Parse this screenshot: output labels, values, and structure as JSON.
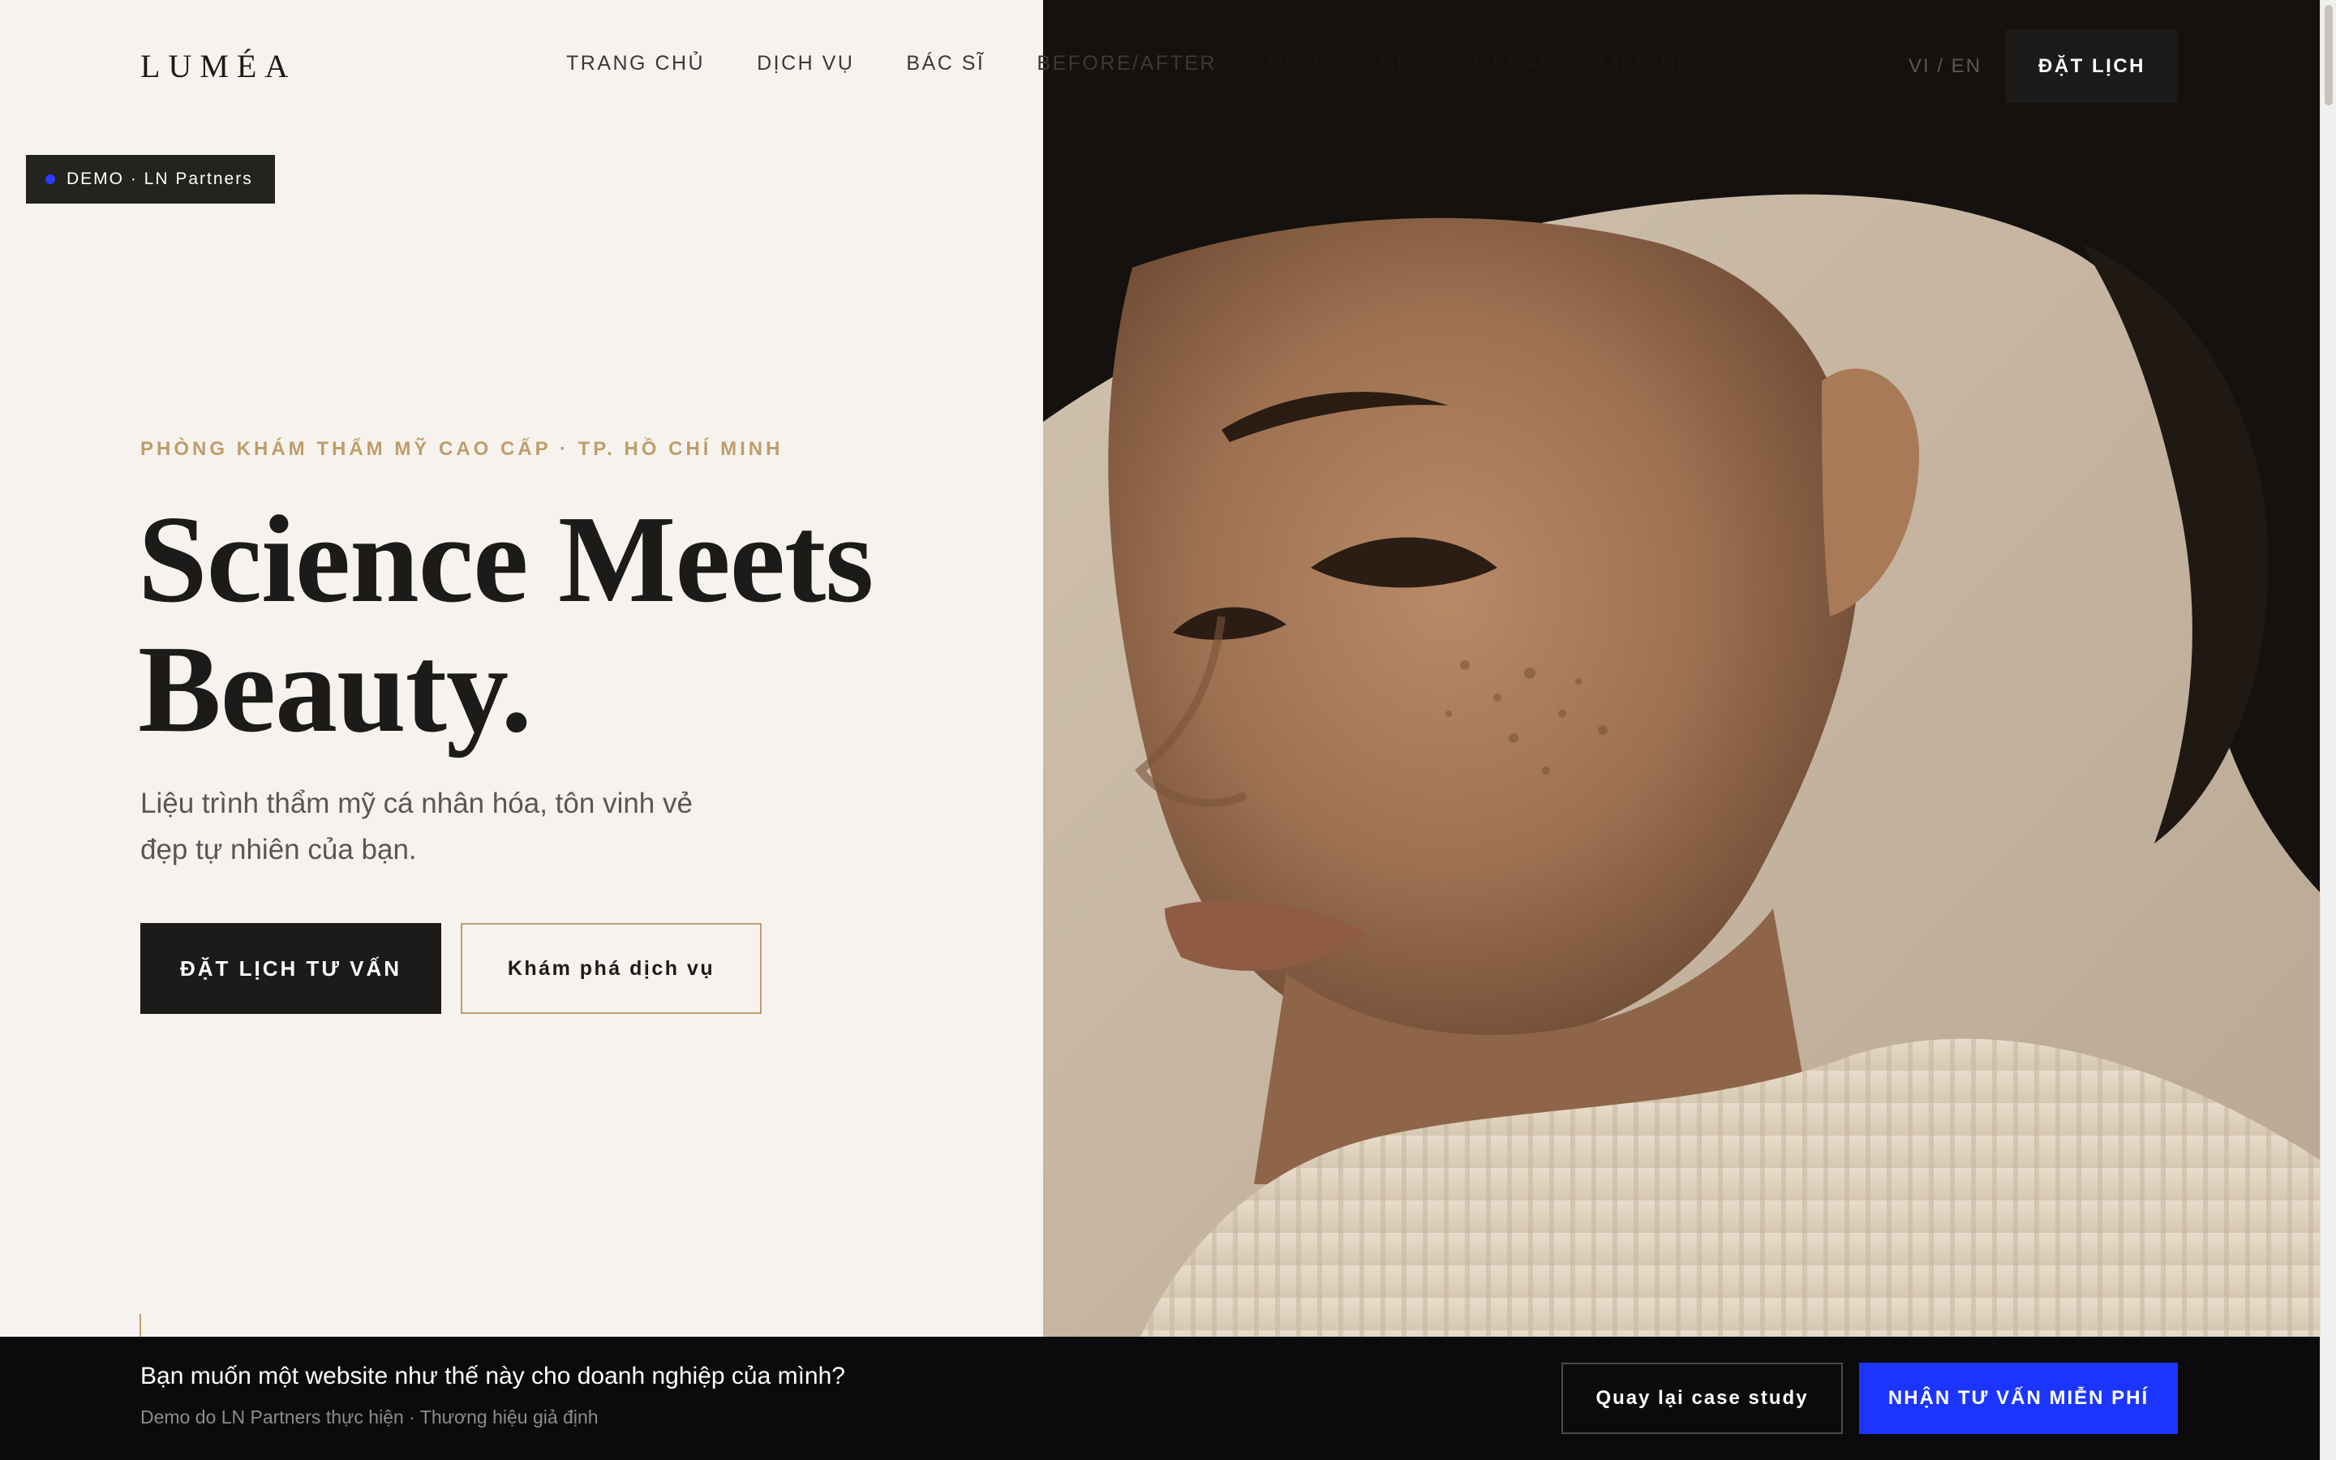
{
  "header": {
    "logo": "LUMÉA",
    "nav": [
      "TRANG CHỦ",
      "DỊCH VỤ",
      "BÁC SĨ",
      "BEFORE/AFTER",
      "CÔNG NGHỆ",
      "ƯU ĐÃI",
      "LIÊN HỆ"
    ],
    "lang": "VI / EN",
    "book_button": "ĐẶT LỊCH"
  },
  "demo_badge": "DEMO · LN Partners",
  "hero": {
    "eyebrow": "PHÒNG KHÁM THẨM MỸ CAO CẤP · TP. HỒ CHÍ MINH",
    "headline_line1": "Science Meets",
    "headline_line2": "Beauty.",
    "subtext": "Liệu trình thẩm mỹ cá nhân hóa, tôn vinh vẻ đẹp tự nhiên của bạn.",
    "primary_button": "ĐẶT LỊCH TƯ VẤN",
    "secondary_button": "Khám phá dịch vụ"
  },
  "bottom_bar": {
    "title": "Bạn muốn một website như thế này cho doanh nghiệp của mình?",
    "subtitle": "Demo do LN Partners thực hiện · Thương hiệu giả định",
    "back_button": "Quay lại case study",
    "consult_button": "NHẬN TƯ VẤN MIỄN PHÍ"
  },
  "colors": {
    "background": "#f6f3ef",
    "accent_gold": "#bf9d6a",
    "dark": "#1c1b19",
    "cta_blue": "#1b35ff",
    "bottom_bar": "#0b0b0b"
  }
}
